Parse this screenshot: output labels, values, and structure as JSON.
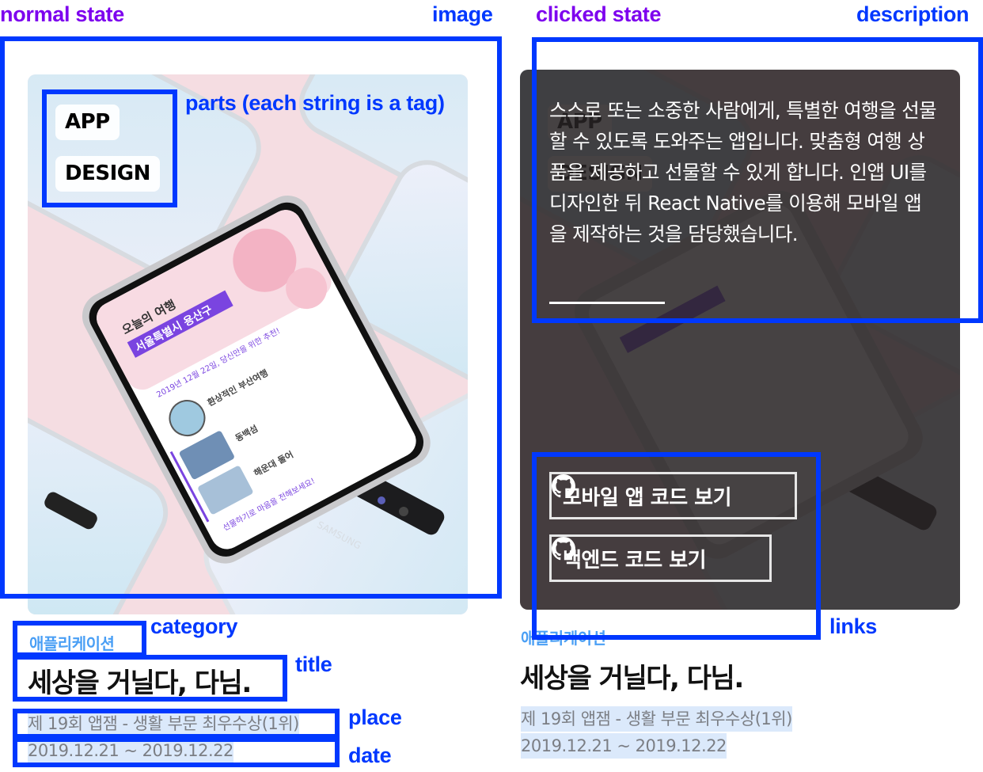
{
  "annotations": {
    "normal_state": "normal state",
    "clicked_state": "clicked state",
    "image": "image",
    "description": "description",
    "parts": "parts (each string is a tag)",
    "category": "category",
    "title": "title",
    "place": "place",
    "date": "date",
    "links": "links"
  },
  "colors": {
    "annotation_purple": "#7d00ee",
    "annotation_blue": "#0038ff",
    "category_blue": "#4a9ff5",
    "title_black": "#111111",
    "meta_gray": "#7b7e84",
    "meta_highlight": "#dbe9fb",
    "image_bg_pink": "#f5dde2",
    "overlay_dark": "#282324"
  },
  "project": {
    "parts": [
      "APP",
      "DESIGN"
    ],
    "image_semantic": "samsung-phones-mockup",
    "category": "애플리케이션",
    "title": "세상을 거닐다, 다님.",
    "place": "제 19회 앱잼 - 생활 부문 최우수상(1위)",
    "date": "2019.12.21 ~ 2019.12.22",
    "description": "스스로 또는 소중한 사람에게, 특별한 여행을 선물할 수 있도록 도와주는 앱입니다. 맞춤형 여행 상품을 제공하고 선물할 수 있게 합니다. 인앱 UI를 디자인한 뒤 React Native를 이용해 모바일 앱을 제작하는 것을 담당했습니다.",
    "links": [
      {
        "label": "모바일 앱 코드 보기",
        "icon": "github-icon"
      },
      {
        "label": "백엔드 코드 보기",
        "icon": "github-icon"
      }
    ]
  }
}
